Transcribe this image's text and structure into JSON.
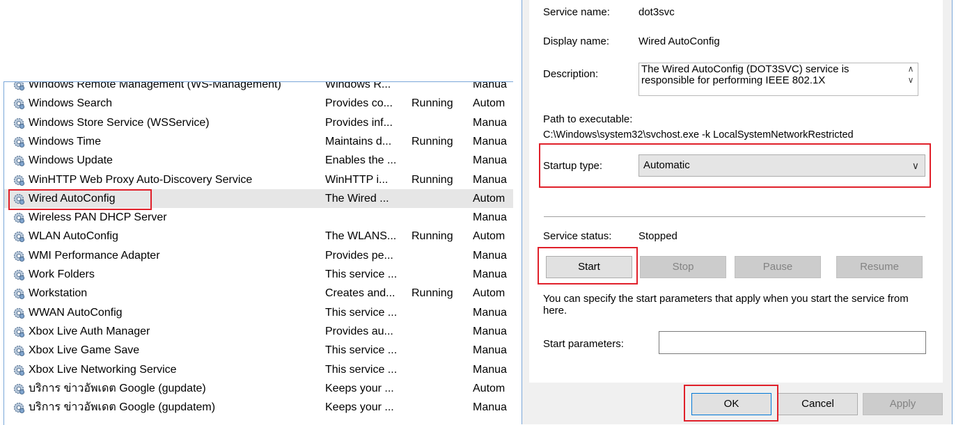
{
  "services": [
    {
      "name": "Windows Remote Management (WS-Management)",
      "desc": "Windows R...",
      "status": "",
      "startup": "Manua"
    },
    {
      "name": "Windows Search",
      "desc": "Provides co...",
      "status": "Running",
      "startup": "Autom"
    },
    {
      "name": "Windows Store Service (WSService)",
      "desc": "Provides inf...",
      "status": "",
      "startup": "Manua"
    },
    {
      "name": "Windows Time",
      "desc": "Maintains d...",
      "status": "Running",
      "startup": "Manua"
    },
    {
      "name": "Windows Update",
      "desc": "Enables the ...",
      "status": "",
      "startup": "Manua"
    },
    {
      "name": "WinHTTP Web Proxy Auto-Discovery Service",
      "desc": "WinHTTP i...",
      "status": "Running",
      "startup": "Manua"
    },
    {
      "name": "Wired AutoConfig",
      "desc": "The Wired ...",
      "status": "",
      "startup": "Autom",
      "selected": true
    },
    {
      "name": "Wireless PAN DHCP Server",
      "desc": "",
      "status": "",
      "startup": "Manua"
    },
    {
      "name": "WLAN AutoConfig",
      "desc": "The WLANS...",
      "status": "Running",
      "startup": "Autom"
    },
    {
      "name": "WMI Performance Adapter",
      "desc": "Provides pe...",
      "status": "",
      "startup": "Manua"
    },
    {
      "name": "Work Folders",
      "desc": "This service ...",
      "status": "",
      "startup": "Manua"
    },
    {
      "name": "Workstation",
      "desc": "Creates and...",
      "status": "Running",
      "startup": "Autom"
    },
    {
      "name": "WWAN AutoConfig",
      "desc": "This service ...",
      "status": "",
      "startup": "Manua"
    },
    {
      "name": "Xbox Live Auth Manager",
      "desc": "Provides au...",
      "status": "",
      "startup": "Manua"
    },
    {
      "name": "Xbox Live Game Save",
      "desc": "This service ...",
      "status": "",
      "startup": "Manua"
    },
    {
      "name": "Xbox Live Networking Service",
      "desc": "This service ...",
      "status": "",
      "startup": "Manua"
    },
    {
      "name": "บริการ ข่าวอัพเดต Google (gupdate)",
      "desc": "Keeps your ...",
      "status": "",
      "startup": "Autom"
    },
    {
      "name": "บริการ ข่าวอัพเดต Google (gupdatem)",
      "desc": "Keeps your ...",
      "status": "",
      "startup": "Manua"
    }
  ],
  "dialog": {
    "service_name_label": "Service name:",
    "service_name": "dot3svc",
    "display_name_label": "Display name:",
    "display_name": "Wired AutoConfig",
    "description_label": "Description:",
    "description": "The Wired AutoConfig (DOT3SVC) service is responsible for performing IEEE 802.1X",
    "path_label": "Path to executable:",
    "path": "C:\\Windows\\system32\\svchost.exe -k LocalSystemNetworkRestricted",
    "startup_type_label": "Startup type:",
    "startup_type": "Automatic",
    "service_status_label": "Service status:",
    "service_status": "Stopped",
    "start_label": "Start",
    "stop_label": "Stop",
    "pause_label": "Pause",
    "resume_label": "Resume",
    "hint": "You can specify the start parameters that apply when you start the service from here.",
    "start_params_label": "Start parameters:",
    "start_params_value": "",
    "ok_label": "OK",
    "cancel_label": "Cancel",
    "apply_label": "Apply"
  },
  "colors": {
    "highlight": "#e0202a",
    "selection": "#e6e6e6",
    "border_blue": "#7aa7d9"
  },
  "icons": {
    "service": "gear-icon",
    "scroll_up": "chevron-up-icon",
    "scroll_down": "chevron-down-icon",
    "dropdown": "chevron-down-icon"
  }
}
